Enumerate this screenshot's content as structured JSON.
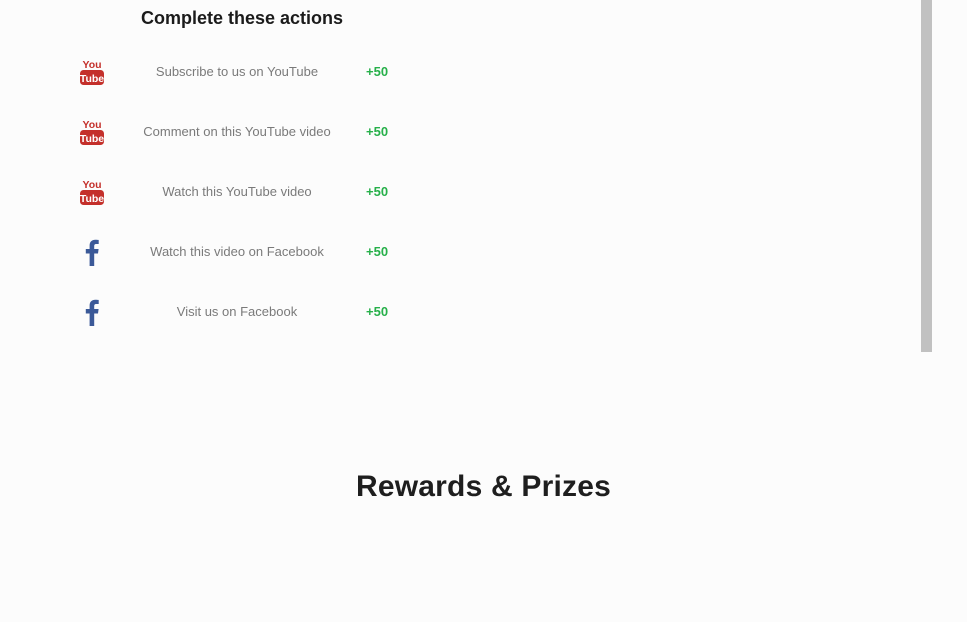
{
  "actions": {
    "heading": "Complete these actions",
    "items": [
      {
        "icon": "youtube-icon",
        "label": "Subscribe to us on YouTube",
        "points": "+50"
      },
      {
        "icon": "youtube-icon",
        "label": "Comment on this YouTube video",
        "points": "+50"
      },
      {
        "icon": "youtube-icon",
        "label": "Watch this YouTube video",
        "points": "+50"
      },
      {
        "icon": "facebook-icon",
        "label": "Watch this video on Facebook",
        "points": "+50"
      },
      {
        "icon": "facebook-icon",
        "label": "Visit us on Facebook",
        "points": "+50"
      }
    ]
  },
  "rewards": {
    "heading": "Rewards & Prizes"
  },
  "colors": {
    "points": "#27b04a",
    "youtube": "#c4302b",
    "facebook": "#3b5998"
  }
}
